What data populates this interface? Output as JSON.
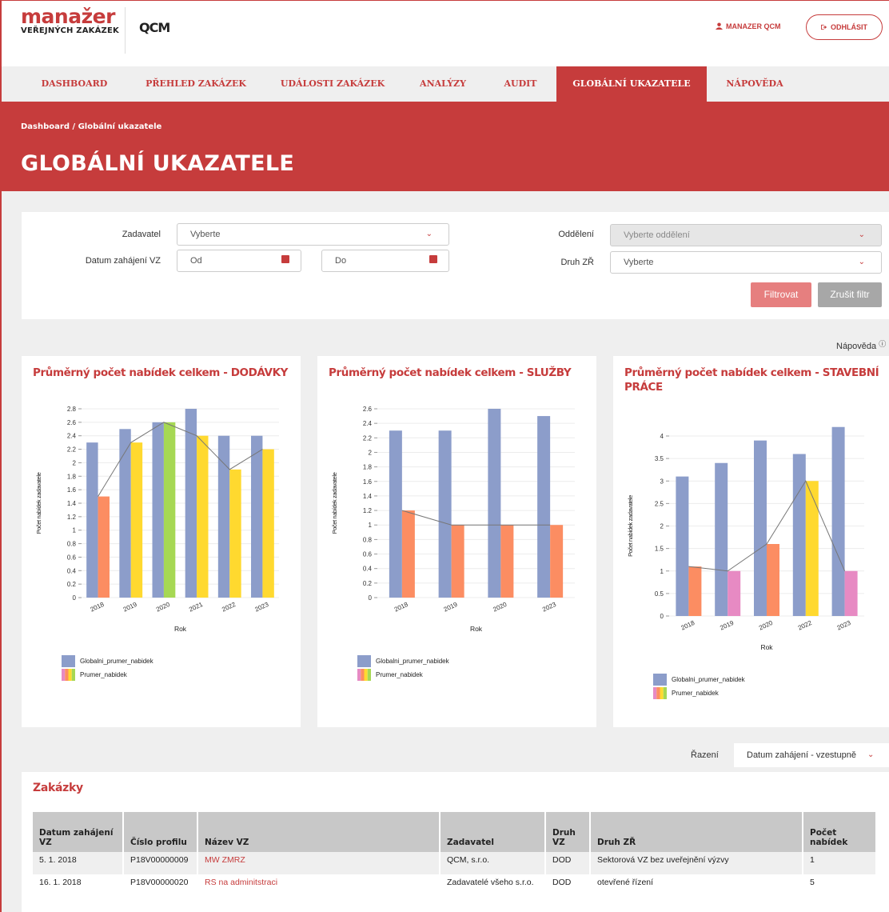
{
  "header": {
    "logo_big": "manažer",
    "logo_small": "VEŘEJNÝCH ZAKÁZEK",
    "brand": "QCM",
    "user": "MANAZER QCM",
    "logout": "ODHLÁSIT",
    "user_icon": "user-icon",
    "logout_icon": "logout-icon"
  },
  "nav": [
    "DASHBOARD",
    "PŘEHLED ZAKÁZEK",
    "UDÁLOSTI ZAKÁZEK",
    "ANALÝZY",
    "AUDIT",
    "GLOBÁLNÍ UKAZATELE",
    "NÁPOVĚDA"
  ],
  "nav_active": 5,
  "breadcrumb": "Dashboard / Globální ukazatele",
  "page_title": "GLOBÁLNÍ UKAZATELE",
  "filter": {
    "zadavatel_label": "Zadavatel",
    "zadavatel_value": "Vyberte",
    "datum_label": "Datum zahájení VZ",
    "od": "Od",
    "do": "Do",
    "oddeleni_label": "Oddělení",
    "oddeleni_placeholder": "Vyberte oddělení",
    "druh_label": "Druh ZŘ",
    "druh_value": "Vyberte",
    "filter_button": "Filtrovat",
    "reset_button": "Zrušit filtr"
  },
  "help": "Nápověda",
  "colors": {
    "accent": "#c63c3c",
    "global": "#8c9dca",
    "orange": "#fc8d62",
    "yellow": "#ffd92f",
    "green": "#a6d854",
    "pink": "#e78ac3"
  },
  "chart_data": [
    {
      "type": "bar",
      "title": "Průměrný počet nabídek celkem - DODÁVKY",
      "xlabel": "Rok",
      "ylabel": "Počet nabídek zadavatele",
      "categories": [
        "2018",
        "2019",
        "2020",
        "2021",
        "2022",
        "2023"
      ],
      "series": [
        {
          "name": "Globalni_prumer_nabidek",
          "values": [
            2.3,
            2.5,
            2.6,
            2.8,
            2.4,
            2.4
          ]
        },
        {
          "name": "Prumer_nabidek",
          "values": [
            1.5,
            2.3,
            2.6,
            2.4,
            1.9,
            2.2
          ],
          "colors": [
            "#fc8d62",
            "#ffd92f",
            "#a6d854",
            "#ffd92f",
            "#ffd92f",
            "#ffd92f"
          ]
        }
      ],
      "ylim": [
        0,
        2.8
      ],
      "yticks": [
        "0",
        "0.2",
        "0.4",
        "0.6",
        "0.8",
        "1",
        "1.2",
        "1.4",
        "1.6",
        "1.8",
        "2",
        "2.2",
        "2.4",
        "2.6",
        "2.8"
      ],
      "legend": [
        "Globalni_prumer_nabidek",
        "Prumer_nabidek"
      ]
    },
    {
      "type": "bar",
      "title": "Průměrný počet nabídek celkem - SLUŽBY",
      "xlabel": "Rok",
      "ylabel": "Počet nabídek zadavatele",
      "categories": [
        "2018",
        "2019",
        "2020",
        "2023"
      ],
      "series": [
        {
          "name": "Globalni_prumer_nabidek",
          "values": [
            2.3,
            2.3,
            2.6,
            2.5
          ]
        },
        {
          "name": "Prumer_nabidek",
          "values": [
            1.2,
            1,
            1,
            1
          ],
          "colors": [
            "#fc8d62",
            "#fc8d62",
            "#fc8d62",
            "#fc8d62"
          ]
        }
      ],
      "ylim": [
        0,
        2.6
      ],
      "yticks": [
        "0",
        "0.2",
        "0.4",
        "0.6",
        "0.8",
        "1",
        "1.2",
        "1.4",
        "1.6",
        "1.8",
        "2",
        "2.2",
        "2.4",
        "2.6"
      ],
      "legend": [
        "Globalni_prumer_nabidek",
        "Prumer_nabidek"
      ]
    },
    {
      "type": "bar",
      "title": "Průměrný počet nabídek celkem - STAVEBNÍ PRÁCE",
      "xlabel": "Rok",
      "ylabel": "Počet nabídek zadavatele",
      "categories": [
        "2018",
        "2019",
        "2020",
        "2022",
        "2023"
      ],
      "series": [
        {
          "name": "Globalni_prumer_nabidek",
          "values": [
            3.1,
            3.4,
            3.9,
            3.6,
            4.2
          ]
        },
        {
          "name": "Prumer_nabidek",
          "values": [
            1.1,
            1,
            1.6,
            3,
            1
          ],
          "colors": [
            "#fc8d62",
            "#e78ac3",
            "#fc8d62",
            "#ffd92f",
            "#e78ac3"
          ]
        }
      ],
      "ylim": [
        0,
        4
      ],
      "yticks": [
        "0",
        "0.5",
        "1",
        "1.5",
        "2",
        "2.5",
        "3",
        "3.5",
        "4"
      ],
      "legend": [
        "Globalni_prumer_nabidek",
        "Prumer_nabidek"
      ]
    }
  ],
  "sort": {
    "label": "Řazení",
    "value": "Datum zahájení - vzestupně"
  },
  "table": {
    "title": "Zakázky",
    "headers": [
      "Datum zahájení VZ",
      "Číslo profilu",
      "Název VZ",
      "Zadavatel",
      "Druh VZ",
      "Druh ZŘ",
      "Počet nabídek"
    ],
    "rows": [
      [
        "5. 1. 2018",
        "P18V00000009",
        "MW ZMRZ",
        "QCM, s.r.o.",
        "DOD",
        "Sektorová VZ bez uveřejnění výzvy",
        "1"
      ],
      [
        "16. 1. 2018",
        "P18V00000020",
        "RS na adminitstraci",
        "Zadavatelé všeho s.r.o.",
        "DOD",
        "otevřené řízení",
        "5"
      ]
    ]
  }
}
